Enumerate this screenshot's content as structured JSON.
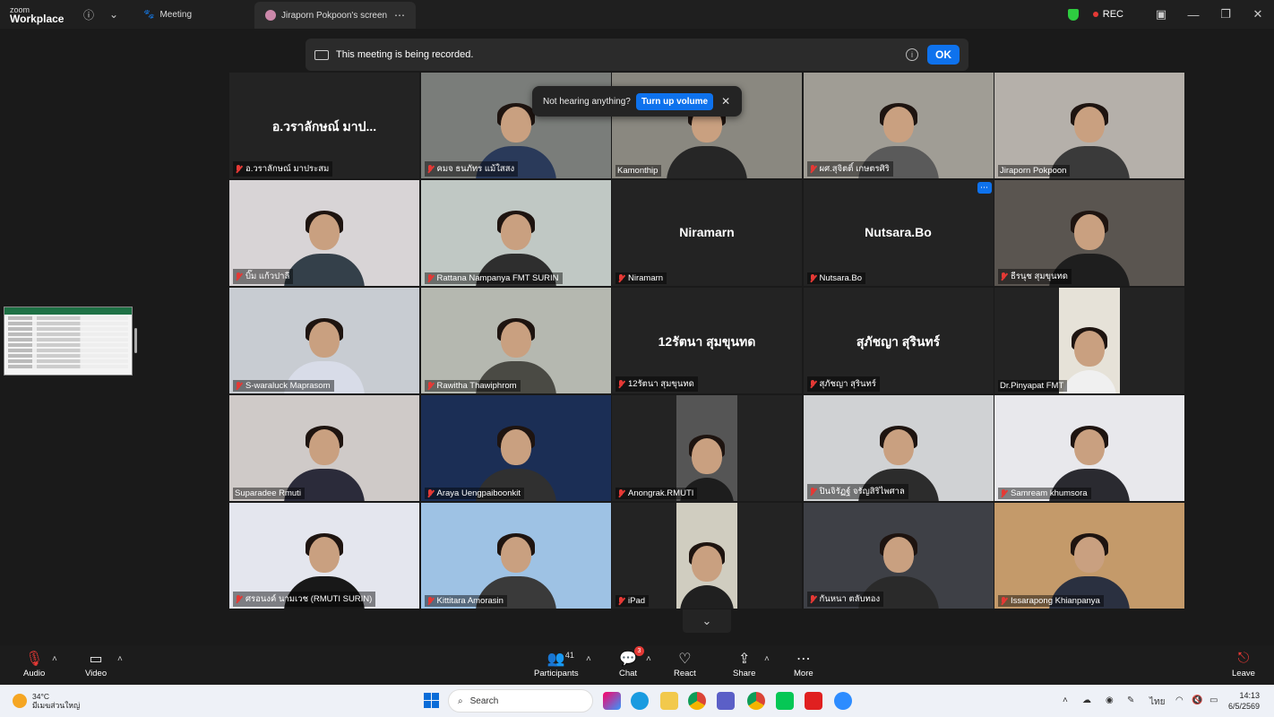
{
  "titlebar": {
    "logo_line1": "zoom",
    "logo_line2": "Workplace",
    "tab_meeting": "Meeting",
    "tab_screen": "Jiraporn Pokpoon's screen",
    "rec_label": "REC"
  },
  "banner": {
    "text": "This meeting is being recorded.",
    "ok_label": "OK"
  },
  "volume_popup": {
    "text": "Not hearing anything?",
    "button": "Turn up volume"
  },
  "colors": {
    "accent": "#0e72ed",
    "active_speaker": "#23d959",
    "mute": "#e53935"
  },
  "tiles": [
    {
      "label": "อ.วราลักษณ์ มาประสม",
      "bigname": "อ.วราลักษณ์ มาป...",
      "muted": true,
      "video": false
    },
    {
      "label": "คมจ ธนภัทร แม้ใสสง",
      "bigname": "",
      "muted": true,
      "video": true,
      "bg": "#7a7d7a",
      "shirt": "#2a3a5a"
    },
    {
      "label": "Kamonthip",
      "bigname": "",
      "muted": false,
      "video": true,
      "bg": "#8a8880",
      "shirt": "#262626",
      "active": true
    },
    {
      "label": "ผศ.สุจิตติ์ เกษตรศิริ",
      "bigname": "",
      "muted": true,
      "video": true,
      "bg": "#a09d95",
      "shirt": "#5a5a5a"
    },
    {
      "label": "Jiraporn Pokpoon",
      "bigname": "",
      "muted": false,
      "video": true,
      "bg": "#b5b0aa",
      "shirt": "#3a3a3a"
    },
    {
      "label": "บิ๊ม แก้วปาลี",
      "bigname": "",
      "muted": true,
      "video": true,
      "bg": "#d8d4d6",
      "shirt": "#34404a"
    },
    {
      "label": "Rattana Nampanya FMT SURIN",
      "bigname": "",
      "muted": true,
      "video": true,
      "bg": "#c0c8c4",
      "shirt": "#2e2e2e"
    },
    {
      "label": "Niramarn",
      "bigname": "Niramarn",
      "muted": true,
      "video": false
    },
    {
      "label": "Nutsara.Bo",
      "bigname": "Nutsara.Bo",
      "muted": true,
      "video": false,
      "more": true
    },
    {
      "label": "ธีรนุช สุมขุนทด",
      "bigname": "",
      "muted": true,
      "video": true,
      "bg": "#5a5550",
      "shirt": "#1e1e1e"
    },
    {
      "label": "S-waraluck Maprasom",
      "bigname": "",
      "muted": true,
      "video": true,
      "bg": "#c8ccd2",
      "shirt": "#d8dce8"
    },
    {
      "label": "Rawitha Thawiphrom",
      "bigname": "",
      "muted": true,
      "video": true,
      "bg": "#b5b8b0",
      "shirt": "#4a4a44"
    },
    {
      "label": "12รัตนา สุมขุนทด",
      "bigname": "12รัตนา สุมขุนทด",
      "muted": true,
      "video": false
    },
    {
      "label": "สุภัชญา สุรินทร์",
      "bigname": "สุภัชญา สุรินทร์",
      "muted": true,
      "video": false
    },
    {
      "label": "Dr.Pinyapat FMT",
      "bigname": "",
      "muted": false,
      "video": true,
      "narrow": true,
      "bg": "#e6e2d8",
      "shirt": "#f0f0f0"
    },
    {
      "label": "Suparadee Rmuti",
      "bigname": "",
      "muted": false,
      "video": true,
      "bg": "#cfcac8",
      "shirt": "#2b2b3a"
    },
    {
      "label": "Araya Uengpaiboonkit",
      "bigname": "",
      "muted": true,
      "video": true,
      "bg": "#1b2e55",
      "shirt": "#303030"
    },
    {
      "label": "Anongrak.RMUTI",
      "bigname": "",
      "muted": true,
      "video": true,
      "narrow": true,
      "bg": "#555",
      "shirt": "#1d1d1d"
    },
    {
      "label": "ปินจิรัฏฐ์ จรัญสิริไพศาล",
      "bigname": "",
      "muted": true,
      "video": true,
      "bg": "#d0d2d4",
      "shirt": "#2c2c2c"
    },
    {
      "label": "Samream khumsora",
      "bigname": "",
      "muted": true,
      "video": true,
      "bg": "#e8e8ec",
      "shirt": "#2a2a30"
    },
    {
      "label": "ศรอนงค์ นามเวช (RMUTI SURIN)",
      "bigname": "",
      "muted": true,
      "video": true,
      "bg": "#e4e6ee",
      "shirt": "#181818"
    },
    {
      "label": "Kittitara Amorasin",
      "bigname": "",
      "muted": true,
      "video": true,
      "bg": "#9ec2e4",
      "shirt": "#3a3a3a"
    },
    {
      "label": "iPad",
      "bigname": "",
      "muted": true,
      "video": true,
      "narrow": true,
      "bg": "#d0cdc0",
      "shirt": "#202020"
    },
    {
      "label": "กันหนา ตลับทอง",
      "bigname": "",
      "muted": true,
      "video": true,
      "bg": "#3e4046",
      "shirt": "#2a2a2a"
    },
    {
      "label": "Issarapong Khianpanya",
      "bigname": "",
      "muted": true,
      "video": true,
      "bg": "#c49a6a",
      "shirt": "#2a3040"
    }
  ],
  "toolbar": {
    "audio": "Audio",
    "video": "Video",
    "participants": "Participants",
    "participants_count": "41",
    "chat": "Chat",
    "chat_badge": "3",
    "react": "React",
    "share": "Share",
    "more": "More",
    "leave": "Leave"
  },
  "taskbar": {
    "temp": "34°C",
    "weather_text": "มีเมฆส่วนใหญ่",
    "search": "Search",
    "lang": "ไทย",
    "time": "14:13",
    "date": "6/5/2569"
  }
}
